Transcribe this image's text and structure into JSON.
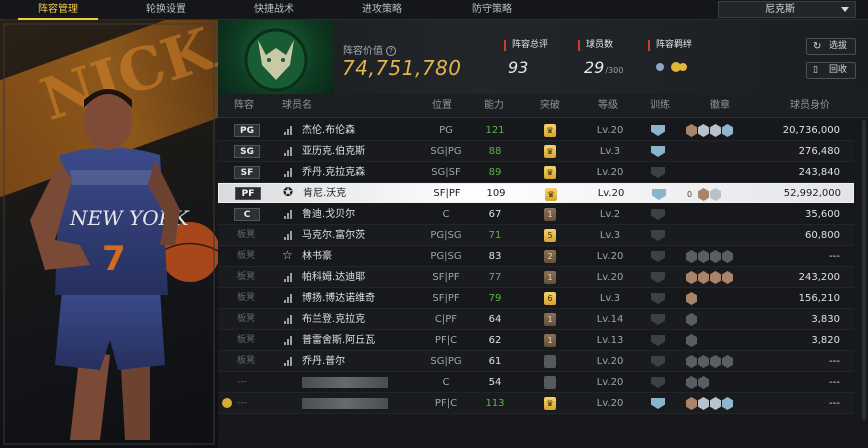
{
  "tabs": [
    {
      "label": "阵容管理",
      "active": true
    },
    {
      "label": "轮换设置",
      "active": false
    },
    {
      "label": "快捷战术",
      "active": false
    },
    {
      "label": "进攻策略",
      "active": false
    },
    {
      "label": "防守策略",
      "active": false
    }
  ],
  "team_select": {
    "value": "尼克斯"
  },
  "header": {
    "value_label": "阵容价值",
    "value": "74,751,780",
    "rating_label": "阵容总评",
    "rating": "93",
    "count_label": "球员数",
    "count": "29",
    "count_max": "/300",
    "bond_label": "阵容羁绊",
    "select_button": "选拔",
    "recycle_button": "回收"
  },
  "columns": {
    "lineup": "阵容",
    "name": "球员名",
    "position": "位置",
    "ability": "能力",
    "breakthrough": "突破",
    "level": "等级",
    "training": "训练",
    "badges": "徽章",
    "salary": "球员身价"
  },
  "rows": [
    {
      "slot": "PG",
      "starter": true,
      "name": "杰伦.布伦森",
      "position": "PG",
      "ability": "121",
      "ability_color": "green",
      "break": "gold",
      "level": "Lv.20",
      "train": "blue",
      "badges": [
        "bronze",
        "silver",
        "silver",
        "blue"
      ],
      "salary": "20,736,000"
    },
    {
      "slot": "SG",
      "starter": true,
      "name": "亚历克.伯克斯",
      "position": "SG|PG",
      "ability": "88",
      "ability_color": "green",
      "break": "gold",
      "level": "Lv.3",
      "train": "blue",
      "badges": [],
      "salary": "276,480"
    },
    {
      "slot": "SF",
      "starter": true,
      "name": "乔丹.克拉克森",
      "position": "SG|SF",
      "ability": "89",
      "ability_color": "green",
      "break": "gold",
      "level": "Lv.20",
      "train": "dim",
      "badges": [],
      "salary": "243,840"
    },
    {
      "slot": "PF",
      "starter": true,
      "selected": true,
      "name": "肯尼.沃克",
      "position": "SF|PF",
      "ability": "109",
      "ability_color": "white",
      "break": "gold",
      "level": "Lv.20",
      "train": "blue",
      "badges": [
        "bronze",
        "silver"
      ],
      "badge_count": "0",
      "salary": "52,992,000"
    },
    {
      "slot": "C",
      "starter": true,
      "name": "鲁迪.戈贝尔",
      "position": "C",
      "ability": "67",
      "ability_color": "white",
      "break": "brown",
      "break_num": "1",
      "level": "Lv.2",
      "train": "dim",
      "badges": [],
      "salary": "35,600"
    },
    {
      "slot": "板凳",
      "starter": false,
      "name": "马克尔.富尔茨",
      "position": "PG|SG",
      "ability": "71",
      "ability_color": "green",
      "break": "gold",
      "break_num": "5",
      "level": "Lv.3",
      "train": "dim",
      "badges": [],
      "salary": "60,800"
    },
    {
      "slot": "板凳",
      "starter": false,
      "star": true,
      "name": "林书豪",
      "position": "PG|SG",
      "ability": "83",
      "ability_color": "white",
      "break": "brown",
      "break_num": "2",
      "level": "Lv.20",
      "train": "dim",
      "badges": [
        "dark",
        "dark",
        "dark",
        "dark"
      ],
      "salary": "---"
    },
    {
      "slot": "板凳",
      "starter": false,
      "name": "帕科姆.达迪耶",
      "position": "SF|PF",
      "ability": "77",
      "ability_color": "green",
      "break": "brown",
      "break_num": "1",
      "level": "Lv.20",
      "train": "dim",
      "badges": [
        "bronze",
        "bronze",
        "bronze",
        "bronze"
      ],
      "salary": "243,200"
    },
    {
      "slot": "板凳",
      "starter": false,
      "name": "博扬.博达诺维奇",
      "position": "SF|PF",
      "ability": "79",
      "ability_color": "green",
      "break": "gold",
      "break_num": "6",
      "level": "Lv.3",
      "train": "dim",
      "badges": [
        "bronze"
      ],
      "salary": "156,210"
    },
    {
      "slot": "板凳",
      "starter": false,
      "name": "布兰登.克拉克",
      "position": "C|PF",
      "ability": "64",
      "ability_color": "white",
      "break": "brown",
      "break_num": "1",
      "level": "Lv.14",
      "train": "dim",
      "badges": [
        "dark"
      ],
      "salary": "3,830"
    },
    {
      "slot": "板凳",
      "starter": false,
      "name": "普雷舍斯.阿丘瓦",
      "position": "PF|C",
      "ability": "62",
      "ability_color": "white",
      "break": "brown",
      "break_num": "1",
      "level": "Lv.13",
      "train": "dim",
      "badges": [
        "dark"
      ],
      "salary": "3,820"
    },
    {
      "slot": "板凳",
      "starter": false,
      "name": "乔丹.普尔",
      "position": "SG|PG",
      "ability": "61",
      "ability_color": "white",
      "break": "gray",
      "level": "Lv.20",
      "train": "dim",
      "badges": [
        "dark",
        "dark",
        "dark",
        "dark"
      ],
      "salary": "---"
    },
    {
      "slot": "---",
      "starter": false,
      "blurred": true,
      "name": "",
      "position": "C",
      "ability": "54",
      "ability_color": "white",
      "break": "gray",
      "level": "Lv.20",
      "train": "dim",
      "badges": [
        "dark",
        "dark"
      ],
      "salary": "---"
    },
    {
      "slot": "---",
      "starter": false,
      "blurred": true,
      "medal": true,
      "name": "",
      "position": "PF|C",
      "ability": "113",
      "ability_color": "green",
      "break": "gold",
      "level": "Lv.20",
      "train": "blue",
      "badges": [
        "bronze",
        "silver",
        "silver",
        "blue"
      ],
      "salary": "---"
    }
  ]
}
